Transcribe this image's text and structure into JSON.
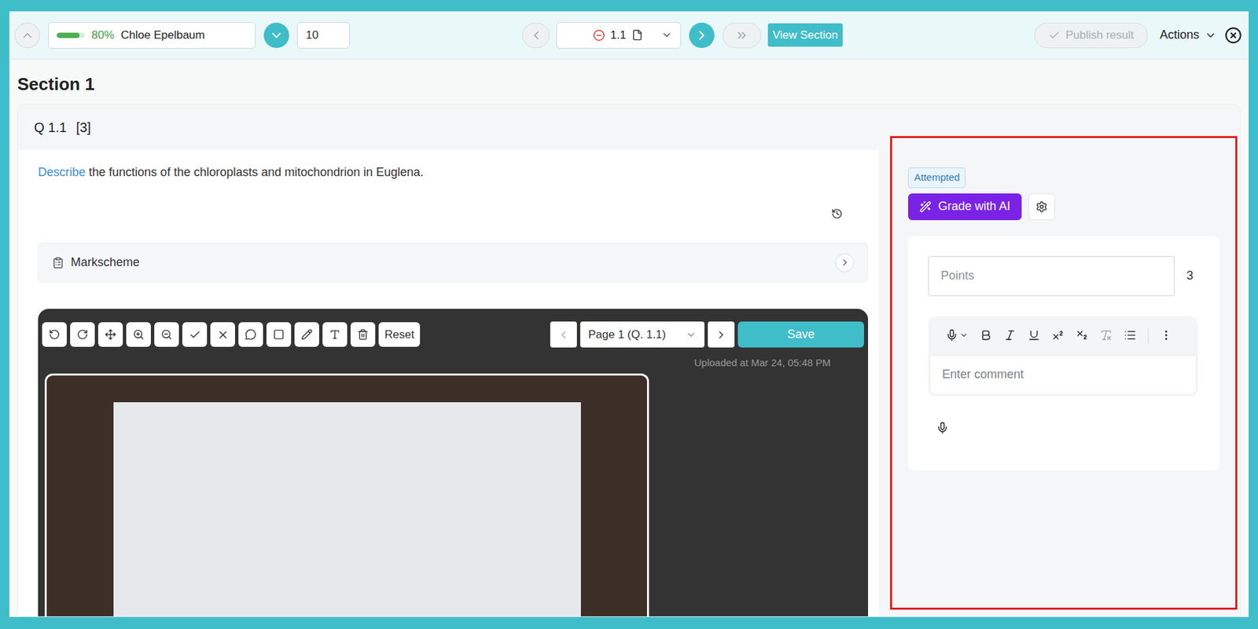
{
  "top_bar": {
    "student": {
      "percent": "80%",
      "level": 0.8,
      "name": "Chloe Epelbaum"
    },
    "page_input": "10",
    "question": "1.1",
    "view_section": "View Section",
    "publish": {
      "label": "Publish result",
      "disabled": true
    },
    "actions": "Actions"
  },
  "section": {
    "title": "Section 1"
  },
  "question": {
    "label": "Q 1.1",
    "marks": "[3]",
    "keyword": "Describe",
    "text": "the functions of the chloroplasts and mitochondrion in Euglena."
  },
  "markscheme": {
    "label": "Markscheme"
  },
  "annotation": {
    "reset": "Reset",
    "page": "Page 1 (Q. 1.1)",
    "save": "Save",
    "uploaded": "Uploaded at Mar 24, 05:48 PM"
  },
  "grading": {
    "badge": "Attempted",
    "grade_button": "Grade with AI",
    "points_placeholder": "Points",
    "max_points": "3",
    "comment_placeholder": "Enter comment"
  }
}
